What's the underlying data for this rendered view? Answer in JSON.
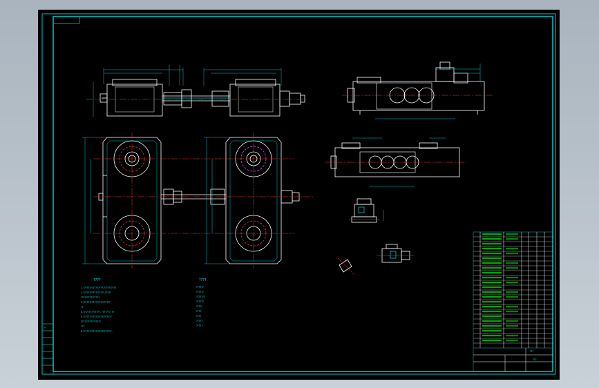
{
  "drawing": {
    "title_block": {
      "title": "???",
      "sheet_code": "?1?"
    },
    "notes_heading": "????",
    "notes_lines": [
      "1.????????????????,??????????.",
      "2.?????????????????,?????",
      "  ???????????????.",
      "3.??????????????????????",
      "  ??.",
      "4.??:???????????, ???????, ??",
      "5.???????????????????????",
      "  ????????????????.",
      "  ???.",
      "6.???????????????????????."
    ],
    "spec_heading": "????",
    "spec_lines": [
      "??????",
      "??????",
      "???????",
      "??????",
      "?????",
      "????",
      "????",
      "?????",
      "?????"
    ],
    "left_strip_label": "??",
    "colors": {
      "frame": "#00c8c8",
      "lines": "#ffffff",
      "hidden": "#00c8c8",
      "red": "#ff3030",
      "magenta": "#ff40ff",
      "green": "#00e000",
      "yellow": "#e0e000",
      "text": "#00ffff"
    }
  }
}
